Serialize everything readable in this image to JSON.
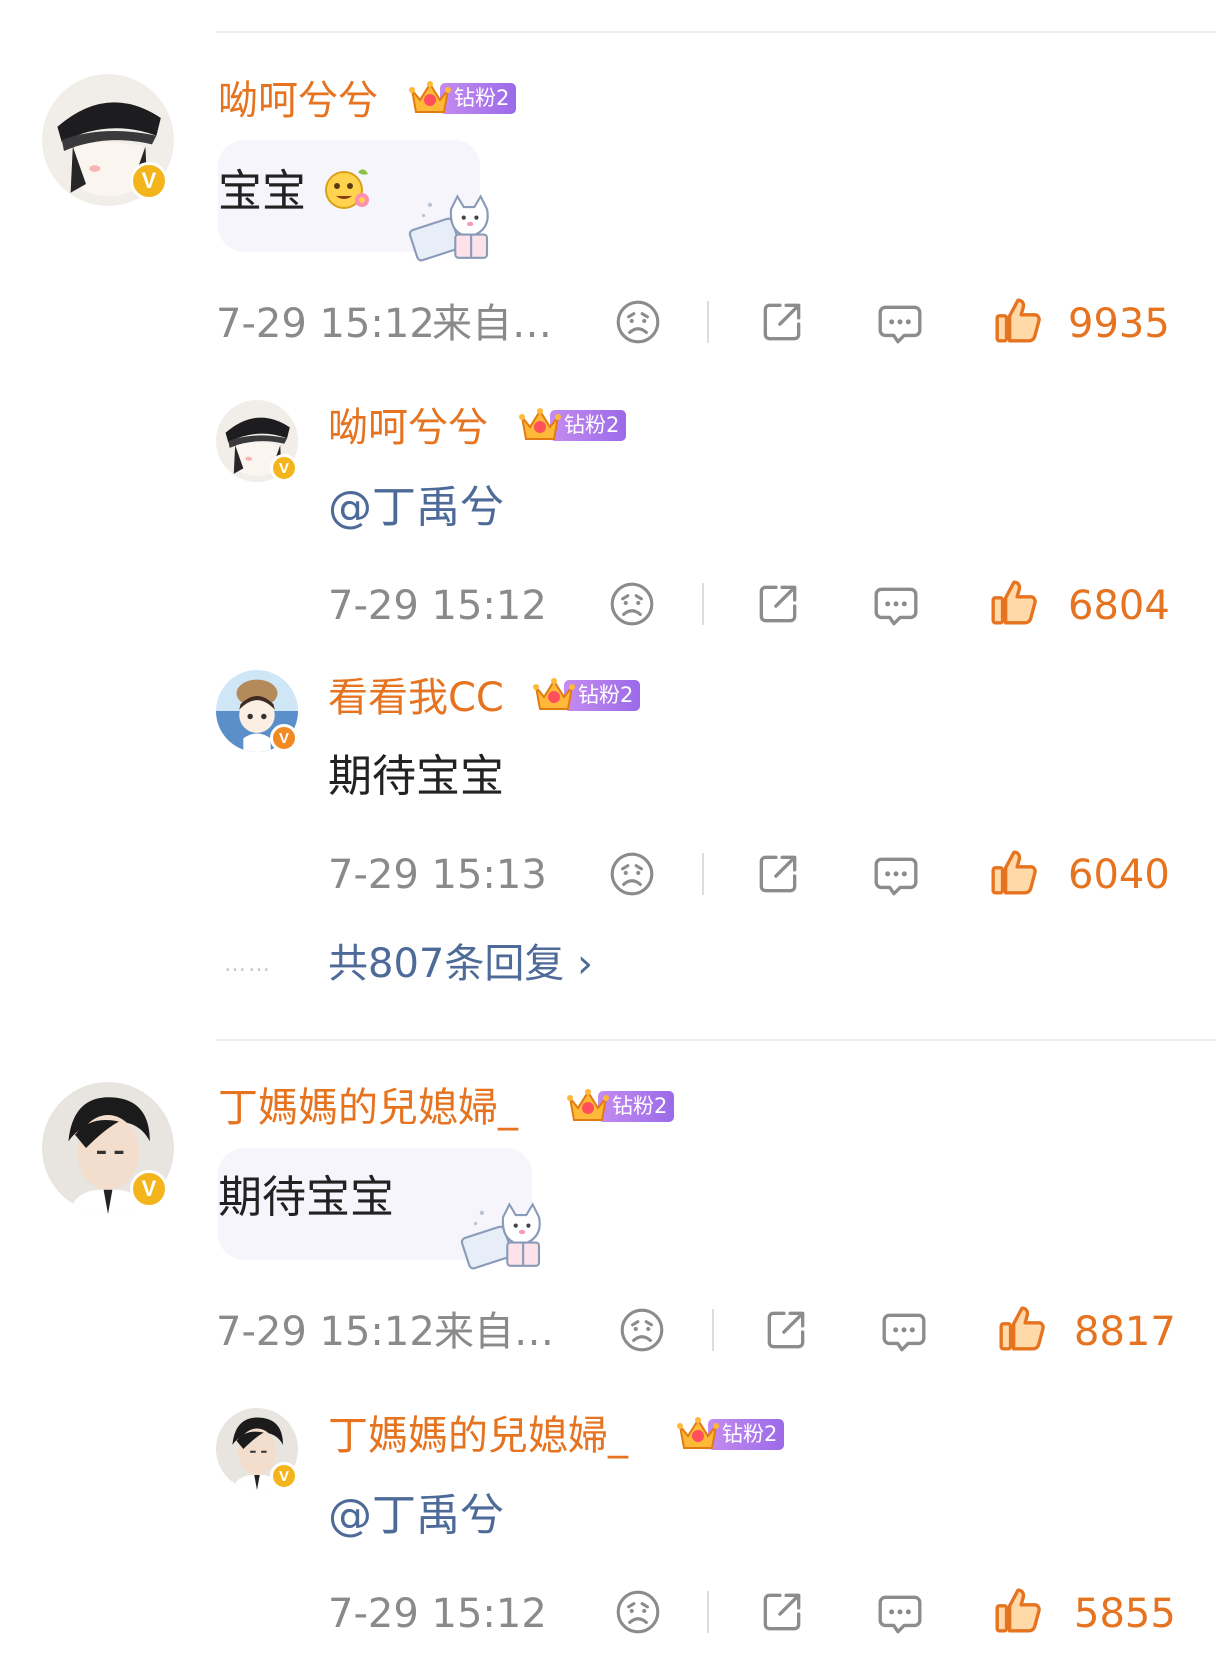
{
  "comments": [
    {
      "user": "呦呵兮兮",
      "fan_badge": "钻粉2",
      "text": "宝宝",
      "time": "7-29 15:12",
      "source": "来自…",
      "likes": "9935",
      "replies": [
        {
          "user": "呦呵兮兮",
          "fan_badge": "钻粉2",
          "text": "@丁禹兮",
          "time": "7-29 15:12",
          "likes": "6804"
        },
        {
          "user": "看看我CC",
          "fan_badge": "钻粉2",
          "text": "期待宝宝",
          "time": "7-29 15:13",
          "likes": "6040"
        }
      ],
      "more_replies": "共807条回复 ›",
      "dots": "……"
    },
    {
      "user": "丁媽媽的兒媳婦_",
      "fan_badge": "钻粉2",
      "text": "期待宝宝",
      "time": "7-29 15:12",
      "source": "来自…",
      "likes": "8817",
      "replies": [
        {
          "user": "丁媽媽的兒媳婦_",
          "fan_badge": "钻粉2",
          "text": "@丁禹兮",
          "time": "7-29 15:12",
          "likes": "5855"
        }
      ]
    }
  ],
  "colors": {
    "username": "#e5731f",
    "mention": "#4d6a98",
    "meta": "#8a8a8a",
    "badge": "#f3b51b",
    "fan_pill": "#a978ea"
  },
  "icons": [
    "sad-face-icon",
    "share-icon",
    "comment-icon",
    "thumbs-up-icon",
    "verified-v-icon",
    "crown-icon",
    "emoji-flower-icon",
    "cat-gift-sticker-icon"
  ]
}
